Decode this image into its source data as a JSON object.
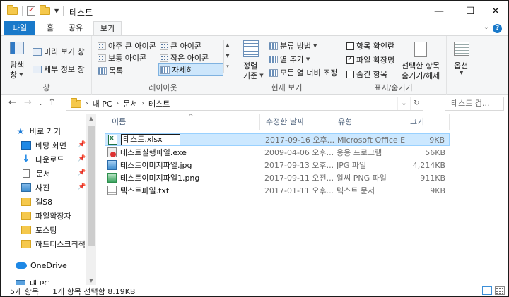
{
  "window": {
    "title": "테스트",
    "minimize": "—",
    "maximize": "☐",
    "close": "✕"
  },
  "ribbon_tabs": [
    {
      "label": "파일"
    },
    {
      "label": "홈"
    },
    {
      "label": "공유"
    },
    {
      "label": "보기"
    }
  ],
  "ribbon": {
    "panes": {
      "nav_pane_label": "탐색",
      "nav_pane_label2": "창",
      "preview": "미리 보기 창",
      "details": "세부 정보 창",
      "group": "창"
    },
    "layout": {
      "items": [
        "아주 큰 아이콘",
        "큰 아이콘",
        "보통 아이콘",
        "작은 아이콘",
        "목록",
        "자세히"
      ],
      "group": "레이아웃"
    },
    "current_view": {
      "sort_label1": "정렬",
      "sort_label2": "기준",
      "group_by": "분류 방법",
      "add_columns": "열 추가",
      "fit_columns": "모든 열 너비 조정",
      "group": "현재 보기"
    },
    "show_hide": {
      "item_checkboxes": "항목 확인란",
      "file_extensions": "파일 확장명",
      "hidden_items": "숨긴 항목",
      "hide_selected1": "선택한 항목",
      "hide_selected2": "숨기기/해제",
      "group": "표시/숨기기"
    },
    "options": {
      "label": "옵션"
    }
  },
  "address": {
    "crumbs": [
      "내 PC",
      "문서",
      "테스트"
    ],
    "search_placeholder": "테스트 검..."
  },
  "nav_pane": {
    "items": [
      {
        "label": "바로 가기"
      },
      {
        "label": "바탕 화면"
      },
      {
        "label": "다운로드"
      },
      {
        "label": "문서"
      },
      {
        "label": "사진"
      },
      {
        "label": "갤S8"
      },
      {
        "label": "파일확장자"
      },
      {
        "label": "포스팅"
      },
      {
        "label": "하드디스크최적:"
      },
      {
        "label": "OneDrive"
      },
      {
        "label": "내 PC"
      }
    ]
  },
  "columns": [
    "이름",
    "수정한 날짜",
    "유형",
    "크기"
  ],
  "files": [
    {
      "name": "테스트.xlsx",
      "date": "2017-09-16 오후...",
      "type": "Microsoft Office E...",
      "size": "9KB"
    },
    {
      "name": "테스트실행파일.exe",
      "date": "2009-04-06 오후...",
      "type": "응용 프로그램",
      "size": "56KB"
    },
    {
      "name": "테스트이미지파일.jpg",
      "date": "2017-09-13 오후...",
      "type": "JPG 파일",
      "size": "4,214KB"
    },
    {
      "name": "테스트이미지파일1.png",
      "date": "2017-09-11 오전...",
      "type": "알씨 PNG 파일",
      "size": "911KB"
    },
    {
      "name": "텍스트파일.txt",
      "date": "2017-01-11 오후...",
      "type": "텍스트 문서",
      "size": "9KB"
    }
  ],
  "status": {
    "count": "5개 항목",
    "selection": "1개 항목 선택함 8.19KB"
  }
}
